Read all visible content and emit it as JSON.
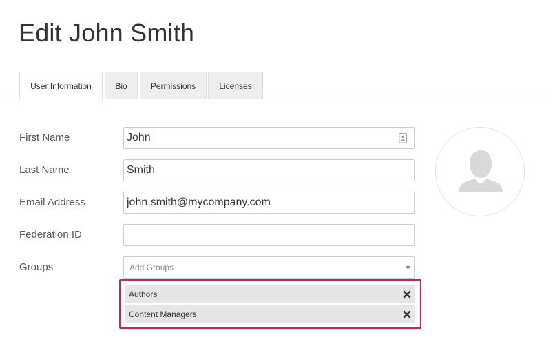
{
  "page": {
    "title": "Edit John Smith"
  },
  "tabs": [
    {
      "label": "User Information",
      "active": true
    },
    {
      "label": "Bio",
      "active": false
    },
    {
      "label": "Permissions",
      "active": false
    },
    {
      "label": "Licenses",
      "active": false
    }
  ],
  "form": {
    "first_name": {
      "label": "First Name",
      "value": "John"
    },
    "last_name": {
      "label": "Last Name",
      "value": "Smith"
    },
    "email": {
      "label": "Email Address",
      "value": "john.smith@mycompany.com"
    },
    "federation_id": {
      "label": "Federation ID",
      "value": ""
    },
    "groups": {
      "label": "Groups",
      "placeholder": "Add Groups",
      "selected": [
        {
          "label": "Authors"
        },
        {
          "label": "Content Managers"
        }
      ]
    }
  },
  "icons": {
    "first_name_field": "contact-card-icon",
    "groups_dropdown": "triangle-down-icon",
    "remove_group": "close-x-icon",
    "avatar": "user-silhouette-icon"
  },
  "colors": {
    "highlight_border": "#cc1f5d",
    "chip_background": "#e6e6e6",
    "tab_inactive_background": "#eeeeee"
  }
}
